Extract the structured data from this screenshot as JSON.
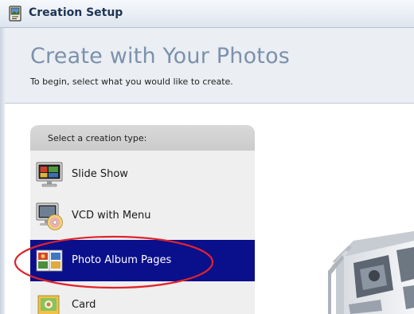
{
  "window": {
    "title": "Creation Setup"
  },
  "header": {
    "title": "Create with Your Photos",
    "subtitle": "To begin, select what you would like to create."
  },
  "panel": {
    "heading": "Select a creation type:",
    "options": [
      {
        "label": "Slide Show",
        "icon": "slideshow-monitor-icon",
        "selected": false
      },
      {
        "label": "VCD with Menu",
        "icon": "vcd-disc-icon",
        "selected": false
      },
      {
        "label": "Photo Album Pages",
        "icon": "photo-album-icon",
        "selected": true
      },
      {
        "label": "Card",
        "icon": "card-icon",
        "selected": false
      }
    ]
  },
  "colors": {
    "selection": "#0a0f8c",
    "highlight_ellipse": "#e0232a",
    "header_title": "#7b91ad"
  }
}
